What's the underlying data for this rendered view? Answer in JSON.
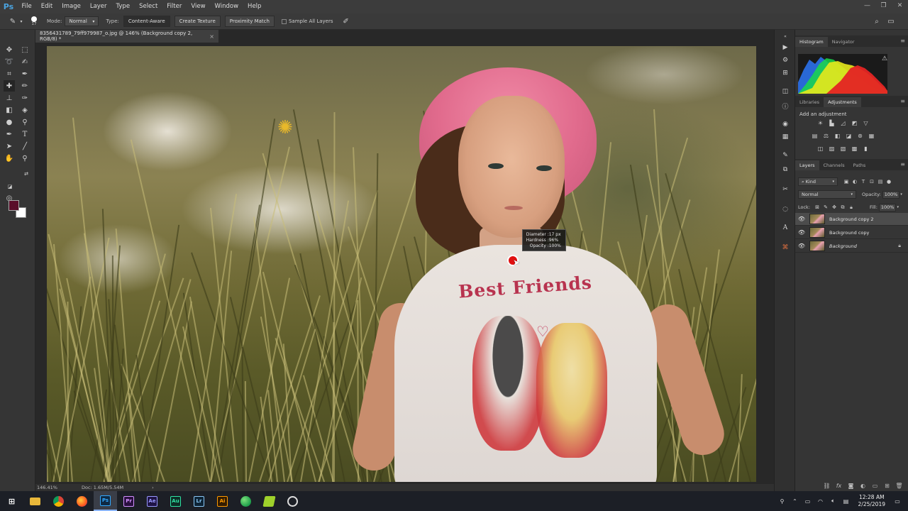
{
  "app": {
    "logo": "Ps"
  },
  "menu": [
    "File",
    "Edit",
    "Image",
    "Layer",
    "Type",
    "Select",
    "Filter",
    "View",
    "Window",
    "Help"
  ],
  "window_controls": {
    "minimize": "—",
    "restore": "❐",
    "close": "✕"
  },
  "options": {
    "brush_size": "17",
    "mode_label": "Mode:",
    "mode_value": "Normal",
    "type_label": "Type:",
    "btn_content_aware": "Content-Aware",
    "btn_create_texture": "Create Texture",
    "btn_proximity_match": "Proximity Match",
    "sample_all_layers": "Sample All Layers"
  },
  "document": {
    "tab_title": "8356431789_79ff979987_o.jpg @ 146% (Background copy 2, RGB/8) *",
    "tab_close": "×",
    "shirt_text": "Best Friends"
  },
  "brush_hud": {
    "diameter_label": "Diameter :",
    "diameter_value": "17 px",
    "hardness_label": "Hardness :",
    "hardness_value": "96%",
    "opacity_label": "Opacity :",
    "opacity_value": "100%"
  },
  "status": {
    "zoom": "146.41%",
    "doc_size": "Doc: 1.65M/5.54M",
    "arrow": "›"
  },
  "panels": {
    "histogram_tabs": [
      "Histogram",
      "Navigator"
    ],
    "adjustment_tabs": [
      "Libraries",
      "Adjustments"
    ],
    "add_adjustment": "Add an adjustment",
    "layers_tabs": [
      "Layers",
      "Channels",
      "Paths"
    ],
    "kind_filter": "Kind",
    "blend_mode": "Normal",
    "opacity_label": "Opacity:",
    "opacity_value": "100%",
    "lock_label": "Lock:",
    "fill_label": "Fill:",
    "fill_value": "100%"
  },
  "layers": [
    {
      "name": "Background copy 2",
      "selected": true,
      "italic": false,
      "locked": false
    },
    {
      "name": "Background copy",
      "selected": false,
      "italic": false,
      "locked": false
    },
    {
      "name": "Background",
      "selected": false,
      "italic": true,
      "locked": true
    }
  ],
  "colors": {
    "foreground": "#5a0e2a",
    "background": "#ffffff",
    "accent": "#4aa3df"
  },
  "taskbar": {
    "apps": [
      "windows-start",
      "file-explorer",
      "chrome",
      "firefox",
      "photoshop",
      "premiere",
      "after-effects",
      "audition",
      "lightroom",
      "illustrator",
      "edge",
      "green-app",
      "blender-like"
    ],
    "time": "12:28 AM",
    "date": "2/25/2019"
  }
}
